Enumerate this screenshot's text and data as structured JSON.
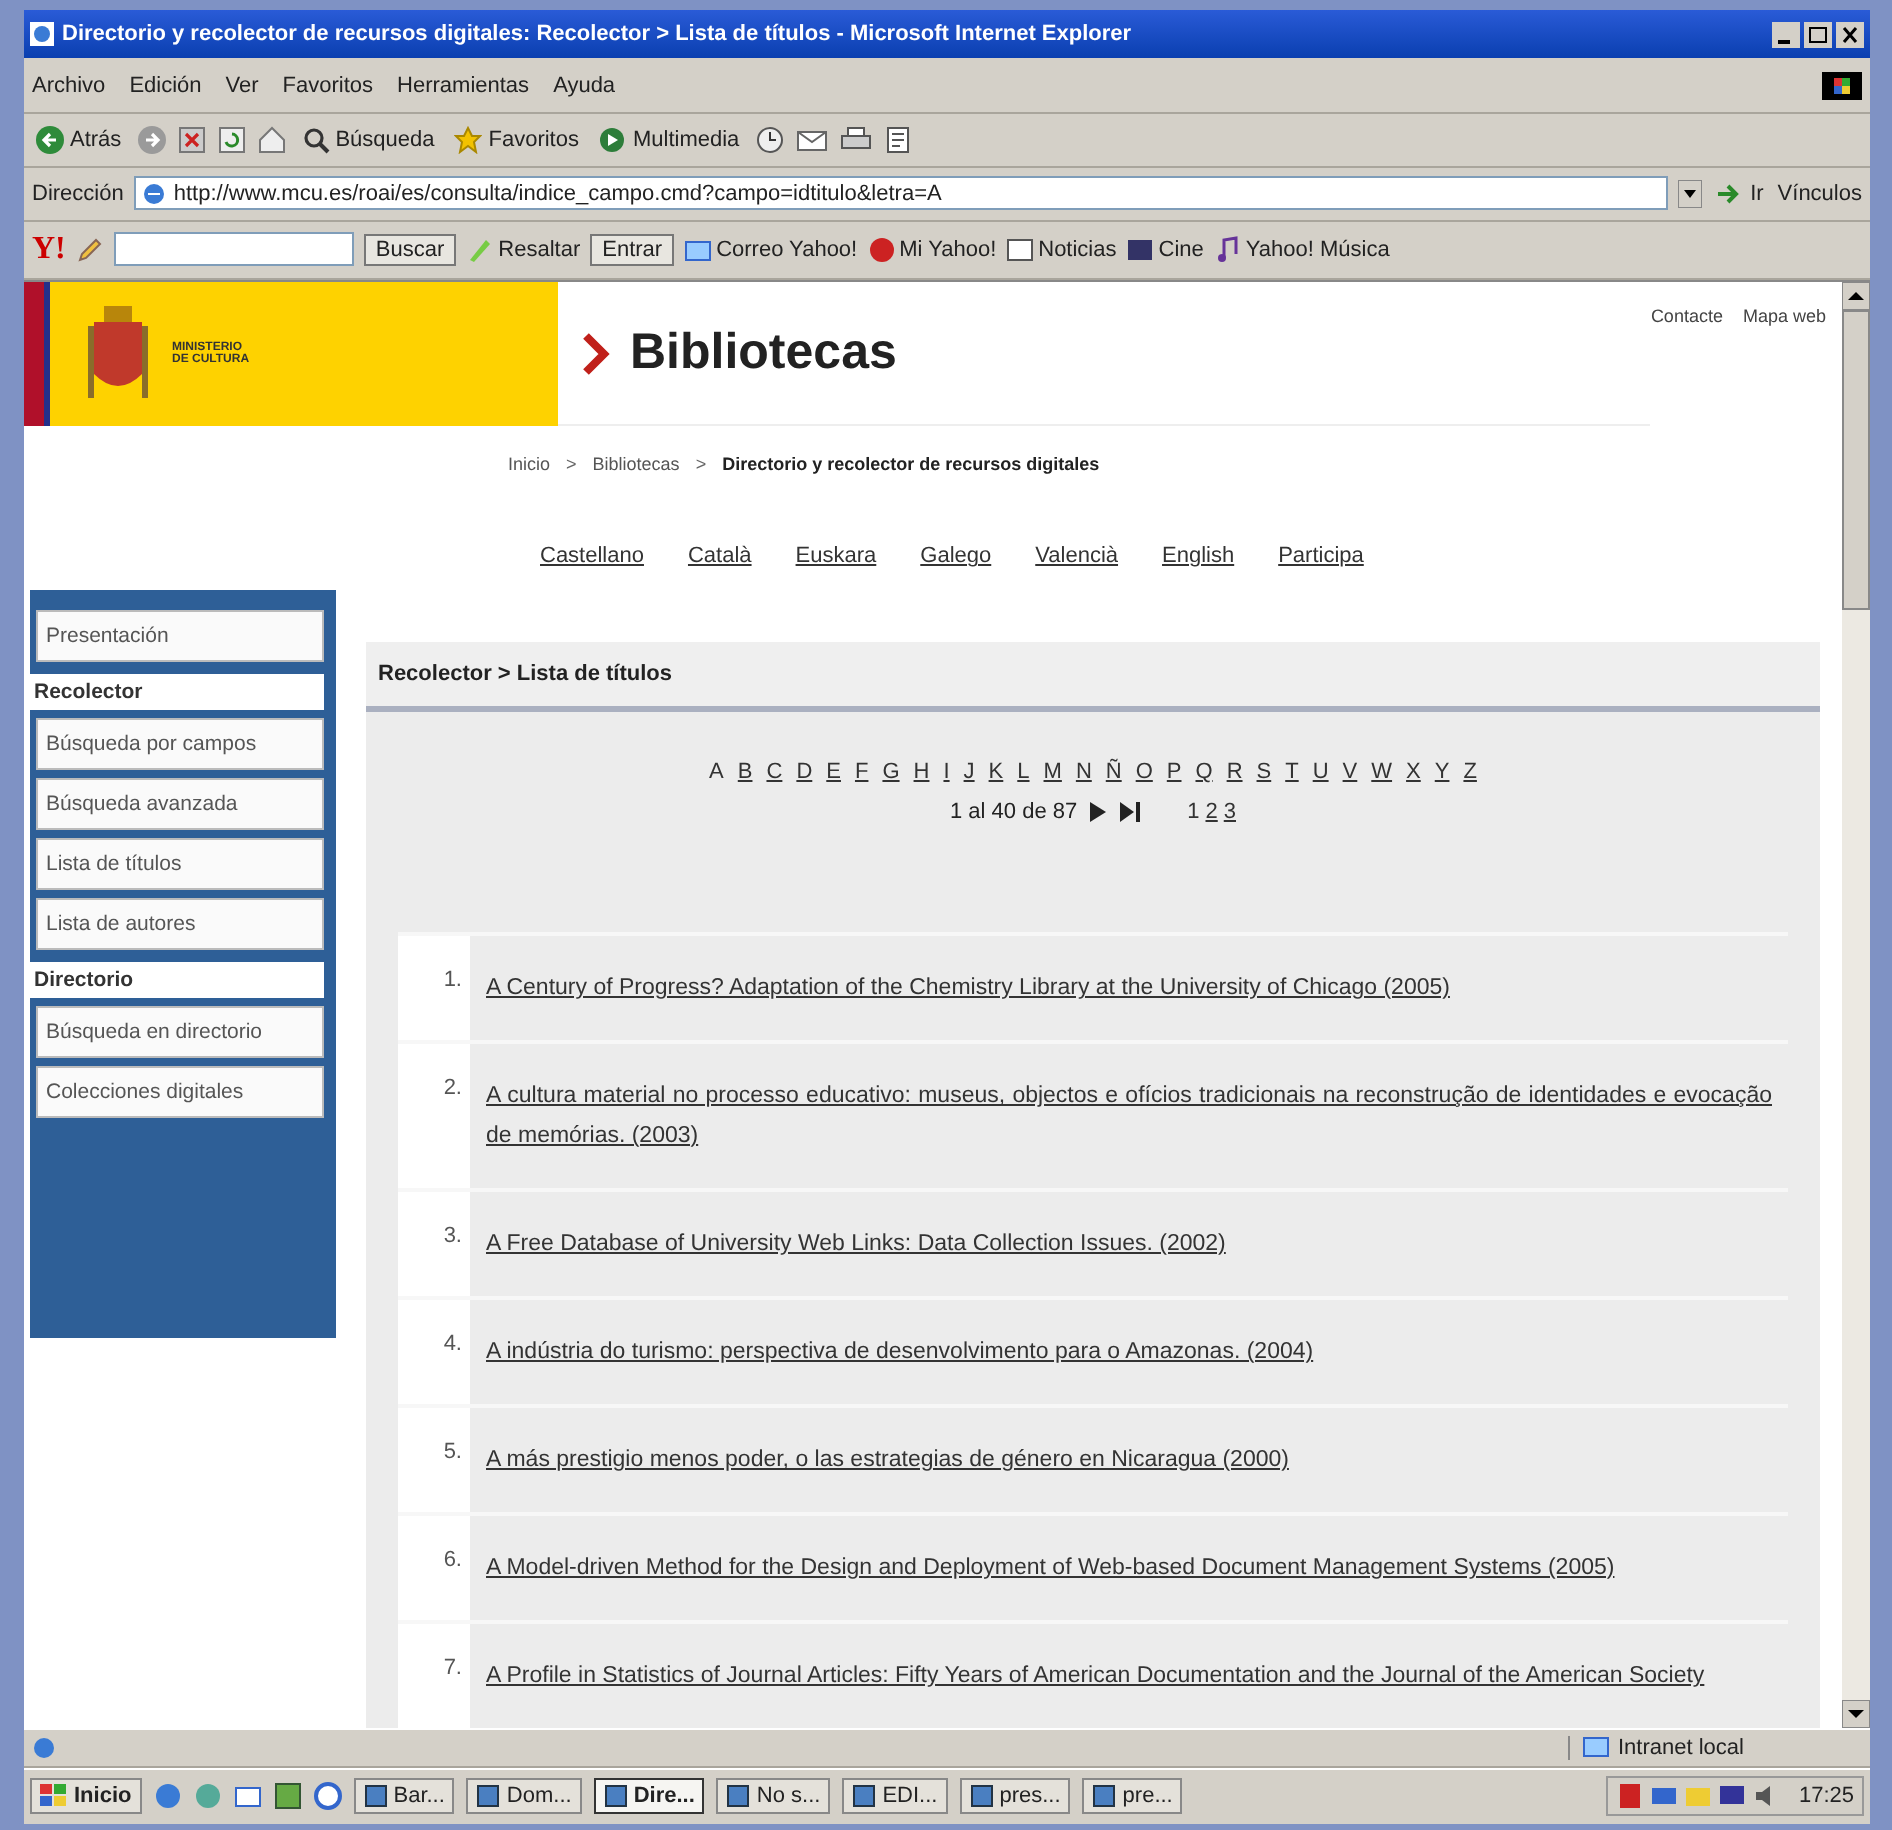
{
  "window": {
    "title": "Directorio y recolector de recursos digitales: Recolector > Lista de títulos - Microsoft Internet Explorer"
  },
  "menu": [
    "Archivo",
    "Edición",
    "Ver",
    "Favoritos",
    "Herramientas",
    "Ayuda"
  ],
  "toolbar": {
    "back": "Atrás",
    "buttons": [
      "Búsqueda",
      "Favoritos",
      "Multimedia"
    ]
  },
  "address": {
    "label": "Dirección",
    "value": "http://www.mcu.es/roai/es/consulta/indice_campo.cmd?campo=idtitulo&letra=A",
    "go": "Ir",
    "links": "Vínculos"
  },
  "yahoo_bar": {
    "logo": "Y!",
    "search_button": "Buscar",
    "items": [
      "Resaltar",
      "Entrar",
      "Correo Yahoo!",
      "Mi Yahoo!",
      "Noticias",
      "Cine",
      "Yahoo! Música"
    ]
  },
  "page": {
    "logo_text": "MINISTERIO DE CULTURA",
    "site_title": "Bibliotecas",
    "top_links": [
      "Contacte",
      "Mapa web"
    ],
    "breadcrumb": [
      {
        "label": "Inicio",
        "current": false
      },
      {
        "separator": ">",
        "label": "Bibliotecas",
        "current": false
      },
      {
        "separator": ">",
        "label": "Directorio y recolector de recursos digitales",
        "current": true
      }
    ],
    "languages": [
      "Castellano",
      "Català",
      "Euskara",
      "Galego",
      "Valencià",
      "English",
      "Participa"
    ],
    "sidebar": [
      {
        "kind": "link",
        "label": "Presentación"
      },
      {
        "kind": "heading",
        "label": "Recolector"
      },
      {
        "kind": "link",
        "label": "Búsqueda por campos"
      },
      {
        "kind": "link",
        "label": "Búsqueda avanzada"
      },
      {
        "kind": "link",
        "label": "Lista de títulos"
      },
      {
        "kind": "link",
        "label": "Lista de autores"
      },
      {
        "kind": "heading",
        "label": "Directorio"
      },
      {
        "kind": "link",
        "label": "Búsqueda en directorio"
      },
      {
        "kind": "link",
        "label": "Colecciones digitales"
      }
    ],
    "panel": {
      "heading": "Recolector > Lista de títulos",
      "letters": [
        {
          "label": "A",
          "selected": true
        },
        {
          "label": "B",
          "selected": false
        },
        {
          "label": "C",
          "selected": false
        },
        {
          "label": "D",
          "selected": false
        },
        {
          "label": "E",
          "selected": false
        },
        {
          "label": "F",
          "selected": false
        },
        {
          "label": "G",
          "selected": false
        },
        {
          "label": "H",
          "selected": false
        },
        {
          "label": "I",
          "selected": false
        },
        {
          "label": "J",
          "selected": false
        },
        {
          "label": "K",
          "selected": false
        },
        {
          "label": "L",
          "selected": false
        },
        {
          "label": "M",
          "selected": false
        },
        {
          "label": "N",
          "selected": false
        },
        {
          "label": "Ñ",
          "selected": false
        },
        {
          "label": "O",
          "selected": false
        },
        {
          "label": "P",
          "selected": false
        },
        {
          "label": "Q",
          "selected": false
        },
        {
          "label": "R",
          "selected": false
        },
        {
          "label": "S",
          "selected": false
        },
        {
          "label": "T",
          "selected": false
        },
        {
          "label": "U",
          "selected": false
        },
        {
          "label": "V",
          "selected": false
        },
        {
          "label": "W",
          "selected": false
        },
        {
          "label": "X",
          "selected": false
        },
        {
          "label": "Y",
          "selected": false
        },
        {
          "label": "Z",
          "selected": false
        }
      ],
      "range": "1 al 40 de 87",
      "pages": [
        {
          "label": "1",
          "selected": true
        },
        {
          "label": "2",
          "selected": false
        },
        {
          "label": "3",
          "selected": false
        }
      ],
      "results": [
        {
          "number": "1.",
          "title": "A Century of Progress? Adaptation of the Chemistry Library at the University of Chicago (2005)"
        },
        {
          "number": "2.",
          "title": "A cultura material no processo educativo: museus, objectos e ofícios tradicionais na reconstrução de identidades e evocação de memórias. (2003)"
        },
        {
          "number": "3.",
          "title": "A Free Database of University Web Links: Data Collection Issues. (2002)"
        },
        {
          "number": "4.",
          "title": "A indústria do turismo: perspectiva de desenvolvimento para o Amazonas. (2004)"
        },
        {
          "number": "5.",
          "title": "A más prestigio menos poder, o las estrategias de género en Nicaragua (2000)"
        },
        {
          "number": "6.",
          "title": "A Model-driven Method for the Design and Deployment of Web-based Document Management Systems (2005)"
        },
        {
          "number": "7.",
          "title": "A Profile in Statistics of Journal Articles: Fifty Years of American Documentation and the Journal of the American Society"
        }
      ]
    }
  },
  "status_bar": {
    "zone": "Intranet local"
  },
  "taskbar": {
    "start": "Inicio",
    "tasks": [
      {
        "label": "Bar...",
        "selected": false
      },
      {
        "label": "Dom...",
        "selected": false
      },
      {
        "label": "Dire...",
        "selected": true
      },
      {
        "label": "No s...",
        "selected": false
      },
      {
        "label": "EDI...",
        "selected": false
      },
      {
        "label": "pres...",
        "selected": false
      },
      {
        "label": "pre...",
        "selected": false
      }
    ],
    "clock": "17:25"
  }
}
